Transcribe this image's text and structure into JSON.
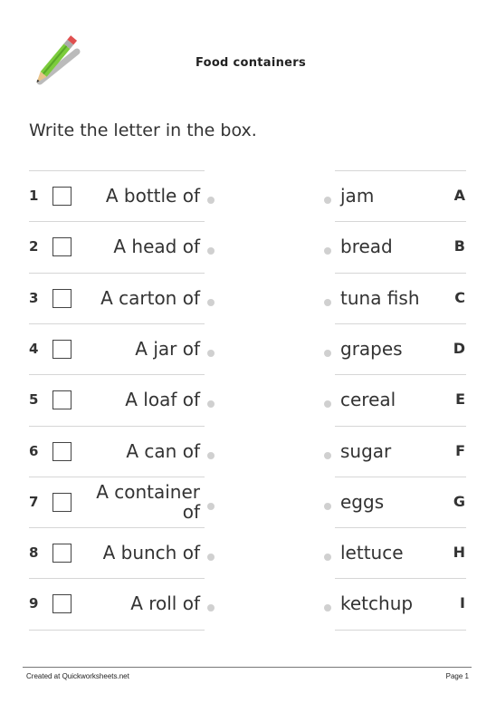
{
  "header": {
    "title": "Food containers",
    "logo_icon": "pencil-icon"
  },
  "instruction": "Write the letter in the box.",
  "rows": [
    {
      "number": "1",
      "phrase": "A bottle of",
      "food": "jam",
      "letter": "A"
    },
    {
      "number": "2",
      "phrase": "A head of",
      "food": "bread",
      "letter": "B"
    },
    {
      "number": "3",
      "phrase": "A carton of",
      "food": "tuna fish",
      "letter": "C"
    },
    {
      "number": "4",
      "phrase": "A jar of",
      "food": "grapes",
      "letter": "D"
    },
    {
      "number": "5",
      "phrase": "A loaf of",
      "food": "cereal",
      "letter": "E"
    },
    {
      "number": "6",
      "phrase": "A can of",
      "food": "sugar",
      "letter": "F"
    },
    {
      "number": "7",
      "phrase": "A container of",
      "food": "eggs",
      "letter": "G"
    },
    {
      "number": "8",
      "phrase": "A bunch of",
      "food": "lettuce",
      "letter": "H"
    },
    {
      "number": "9",
      "phrase": "A roll of",
      "food": "ketchup",
      "letter": "I"
    }
  ],
  "footer": {
    "credit": "Created at Quickworksheets.net",
    "page": "Page 1"
  }
}
